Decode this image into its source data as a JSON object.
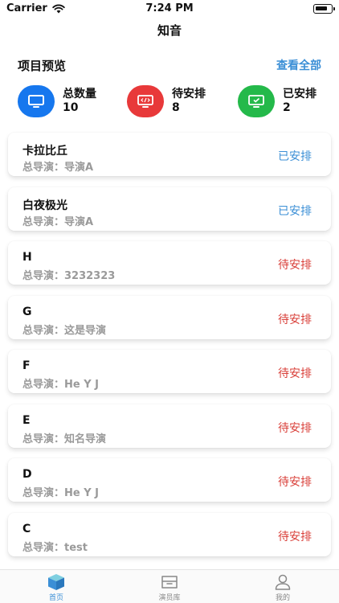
{
  "status_bar": {
    "carrier": "Carrier",
    "time": "7:24 PM"
  },
  "nav": {
    "title": "知音"
  },
  "overview": {
    "title": "项目预览",
    "view_all": "查看全部",
    "stats": [
      {
        "label": "总数量",
        "value": "10",
        "color": "#1677ee",
        "icon": "monitor-icon"
      },
      {
        "label": "待安排",
        "value": "8",
        "color": "#e8393a",
        "icon": "code-screen-icon"
      },
      {
        "label": "已安排",
        "value": "2",
        "color": "#24b94a",
        "icon": "check-screen-icon"
      }
    ]
  },
  "projects": [
    {
      "title": "卡拉比丘",
      "director": "总导演：导演A",
      "status": "已安排"
    },
    {
      "title": "白夜极光",
      "director": "总导演：导演A",
      "status": "已安排"
    },
    {
      "title": "H",
      "director": "总导演：3232323",
      "status": "待安排"
    },
    {
      "title": "G",
      "director": "总导演：这是导演",
      "status": "待安排"
    },
    {
      "title": "F",
      "director": "总导演：He Y J",
      "status": "待安排"
    },
    {
      "title": "E",
      "director": "总导演：知名导演",
      "status": "待安排"
    },
    {
      "title": "D",
      "director": "总导演：He Y J",
      "status": "待安排"
    },
    {
      "title": "C",
      "director": "总导演：test",
      "status": "待安排"
    }
  ],
  "tabbar": {
    "items": [
      {
        "label": "首页",
        "icon": "box-icon",
        "active": true
      },
      {
        "label": "演员库",
        "icon": "archive-icon",
        "active": false
      },
      {
        "label": "我的",
        "icon": "person-icon",
        "active": false
      }
    ]
  },
  "colors": {
    "accent": "#3b8fd6",
    "pending": "#d9403a",
    "muted": "#9a9a9a"
  }
}
